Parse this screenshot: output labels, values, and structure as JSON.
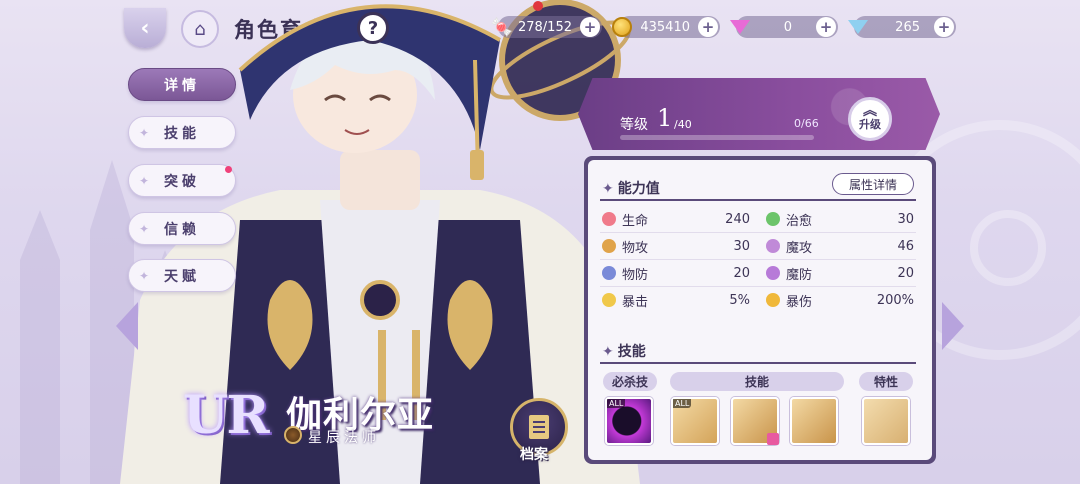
{
  "header": {
    "title": "角色育成",
    "help_label": "?"
  },
  "resources": [
    {
      "name": "stamina",
      "icon": "candy-icon",
      "value": "278/152"
    },
    {
      "name": "gold",
      "icon": "coin-icon",
      "value": "435410"
    },
    {
      "name": "pink_gem",
      "icon": "pink-diamond-icon",
      "value": "0"
    },
    {
      "name": "blue_gem",
      "icon": "blue-diamond-icon",
      "value": "265"
    }
  ],
  "tabs": [
    {
      "label": "详情",
      "active": true
    },
    {
      "label": "技能",
      "active": false
    },
    {
      "label": "突破",
      "active": false,
      "notice": true
    },
    {
      "label": "信赖",
      "active": false
    },
    {
      "label": "天赋",
      "active": false
    }
  ],
  "character": {
    "rarity": "UR",
    "name": "伽利尔亚",
    "class": "星辰法师"
  },
  "archive": {
    "label": "档案"
  },
  "level": {
    "label": "等级",
    "current": "1",
    "max": "/40",
    "exp": "0/66",
    "exp_fraction": 0,
    "upgrade_label": "升级"
  },
  "stats": {
    "title": "能力值",
    "detail_button": "属性详情",
    "items": [
      {
        "name": "生命",
        "value": "240",
        "color": "#f07a8a"
      },
      {
        "name": "治愈",
        "value": "30",
        "color": "#6cc46a"
      },
      {
        "name": "物攻",
        "value": "30",
        "color": "#e0a34a"
      },
      {
        "name": "魔攻",
        "value": "46",
        "color": "#c08ad8"
      },
      {
        "name": "物防",
        "value": "20",
        "color": "#7a8ad8"
      },
      {
        "name": "魔防",
        "value": "20",
        "color": "#b77ad8"
      },
      {
        "name": "暴击",
        "value": "5%",
        "color": "#f0c84a"
      },
      {
        "name": "暴伤",
        "value": "200%",
        "color": "#f0b83a"
      }
    ]
  },
  "skills": {
    "title": "技能",
    "headers": {
      "ultimate": "必杀技",
      "skill": "技能",
      "trait": "特性"
    },
    "badge_all": "ALL"
  }
}
